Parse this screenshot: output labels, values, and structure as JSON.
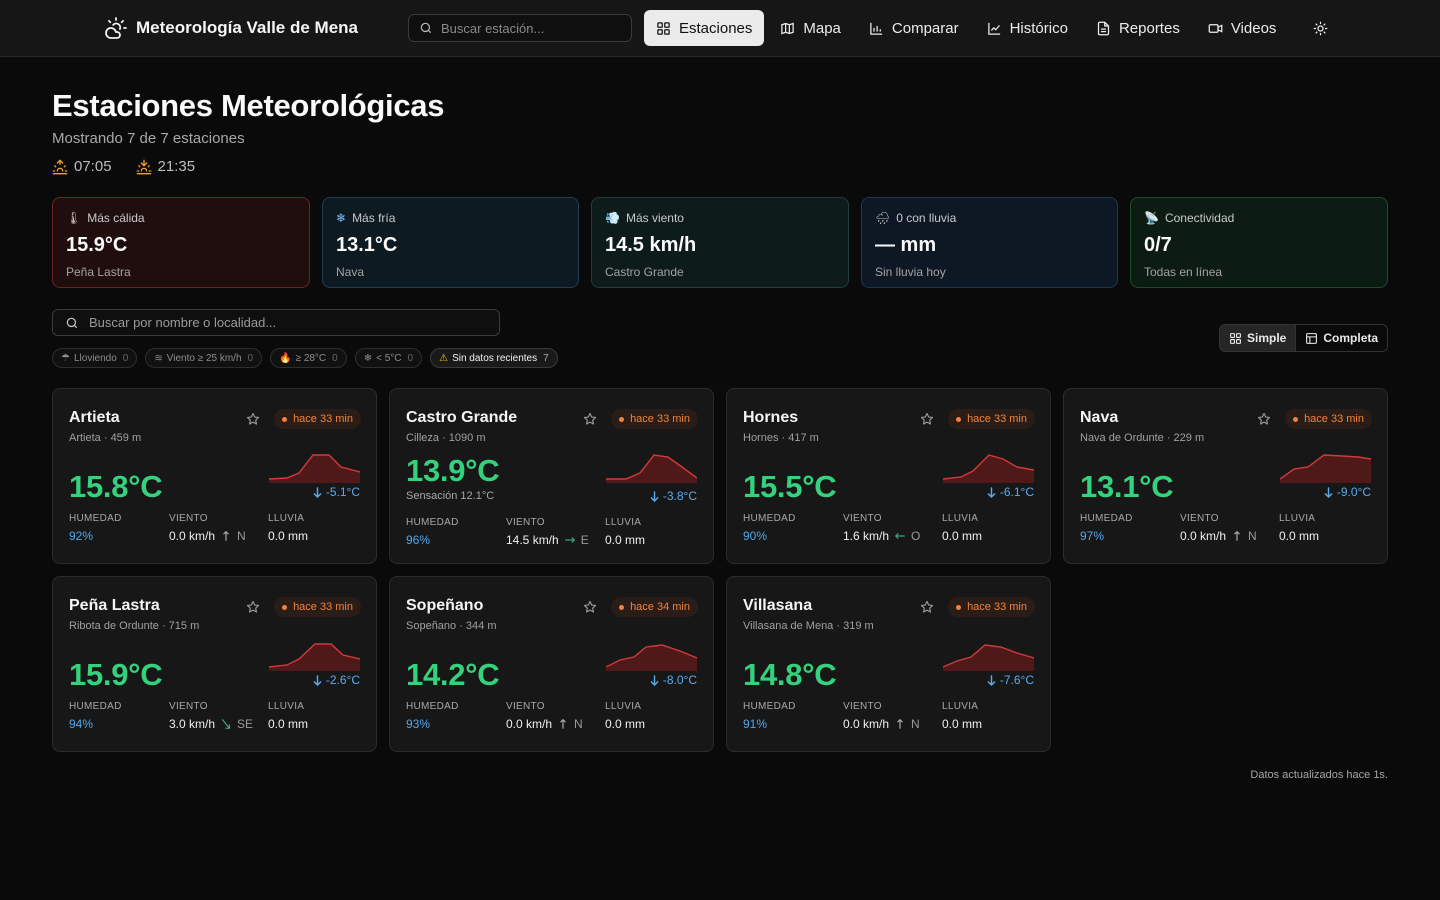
{
  "header": {
    "brand": "Meteorología Valle de Mena",
    "search_placeholder": "Buscar estación...",
    "nav": [
      {
        "label": "Estaciones",
        "icon": "grid-icon",
        "active": true
      },
      {
        "label": "Mapa",
        "icon": "map-icon"
      },
      {
        "label": "Comparar",
        "icon": "bar-chart-icon"
      },
      {
        "label": "Histórico",
        "icon": "line-chart-icon"
      },
      {
        "label": "Reportes",
        "icon": "document-icon"
      },
      {
        "label": "Videos",
        "icon": "video-icon"
      }
    ],
    "theme_icon": "sun-icon"
  },
  "page": {
    "title": "Estaciones Meteorológicas",
    "subtitle": "Mostrando 7 de 7 estaciones",
    "sunrise": "07:05",
    "sunset": "21:35"
  },
  "summary": {
    "hottest": {
      "label": "Más cálida",
      "value": "15.9°C",
      "sub": "Peña Lastra",
      "icon": "thermometer-icon"
    },
    "coldest": {
      "label": "Más fría",
      "value": "13.1°C",
      "sub": "Nava",
      "icon": "snowflake-icon"
    },
    "windiest": {
      "label": "Más viento",
      "value": "14.5 km/h",
      "sub": "Castro Grande",
      "icon": "wind-icon"
    },
    "rain": {
      "label": "0 con lluvia",
      "value": "— mm",
      "sub": "Sin lluvia hoy",
      "icon": "rain-cloud-icon"
    },
    "connectivity": {
      "label": "Conectividad",
      "value": "0/7",
      "sub": "Todas en línea",
      "icon": "satellite-icon"
    }
  },
  "filters": {
    "search_placeholder": "Buscar por nombre o localidad...",
    "chips": [
      {
        "label": "Lloviendo",
        "count": "0"
      },
      {
        "label": "Viento ≥ 25 km/h",
        "count": "0"
      },
      {
        "label": "≥ 28°C",
        "count": "0"
      },
      {
        "label": "< 5°C",
        "count": "0"
      },
      {
        "label": "Sin datos recientes",
        "count": "7"
      }
    ],
    "view_simple": "Simple",
    "view_full": "Completa"
  },
  "labels": {
    "humidity": "HUMEDAD",
    "wind": "VIENTO",
    "rain": "LLUVIA"
  },
  "stations": [
    {
      "name": "Artieta",
      "location": "Artieta · 459 m",
      "badge": "hace 33 min",
      "temp": "15.8°C",
      "delta": "-5.1°C",
      "humidity": "92%",
      "wind": "0.0 km/h",
      "wind_dir": "N",
      "rain": "0.0 mm"
    },
    {
      "name": "Castro Grande",
      "location": "Cilleza · 1090 m",
      "badge": "hace 33 min",
      "temp": "13.9°C",
      "feels": "Sensación 12.1°C",
      "delta": "-3.8°C",
      "humidity": "96%",
      "wind": "14.5 km/h",
      "wind_dir": "E",
      "rain": "0.0 mm"
    },
    {
      "name": "Hornes",
      "location": "Hornes · 417 m",
      "badge": "hace 33 min",
      "temp": "15.5°C",
      "delta": "-6.1°C",
      "humidity": "90%",
      "wind": "1.6 km/h",
      "wind_dir": "O",
      "rain": "0.0 mm"
    },
    {
      "name": "Nava",
      "location": "Nava de Ordunte · 229 m",
      "badge": "hace 33 min",
      "temp": "13.1°C",
      "delta": "-9.0°C",
      "humidity": "97%",
      "wind": "0.0 km/h",
      "wind_dir": "N",
      "rain": "0.0 mm"
    },
    {
      "name": "Peña Lastra",
      "location": "Ribota de Ordunte · 715 m",
      "badge": "hace 33 min",
      "temp": "15.9°C",
      "delta": "-2.6°C",
      "humidity": "94%",
      "wind": "3.0 km/h",
      "wind_dir": "SE",
      "rain": "0.0 mm"
    },
    {
      "name": "Sopeñano",
      "location": "Sopeñano · 344 m",
      "badge": "hace 34 min",
      "temp": "14.2°C",
      "delta": "-8.0°C",
      "humidity": "93%",
      "wind": "0.0 km/h",
      "wind_dir": "N",
      "rain": "0.0 mm"
    },
    {
      "name": "Villasana",
      "location": "Villasana de Mena · 319 m",
      "badge": "hace 33 min",
      "temp": "14.8°C",
      "delta": "-7.6°C",
      "humidity": "91%",
      "wind": "0.0 km/h",
      "wind_dir": "N",
      "rain": "0.0 mm"
    }
  ],
  "footer": {
    "note": "Datos actualizados hace 1s."
  },
  "colors": {
    "accent_temp": "#34d27c",
    "humidity": "#4fa8ee",
    "badge": "#f0833d",
    "spark": "#c83232"
  }
}
